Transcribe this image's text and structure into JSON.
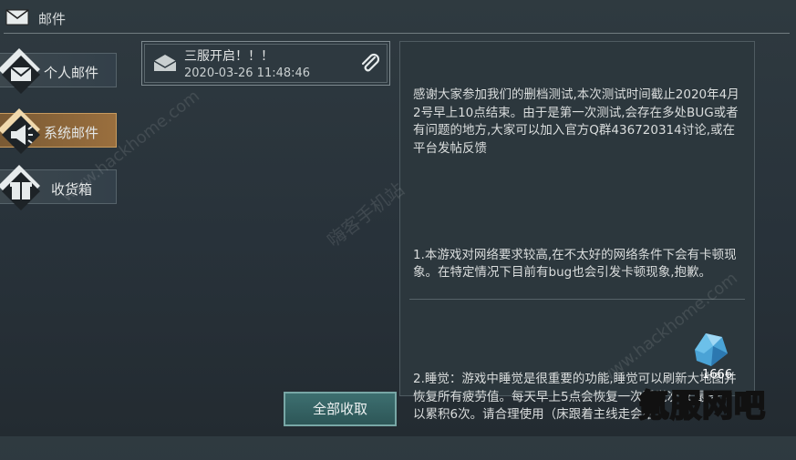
{
  "header": {
    "title": "邮件",
    "icon": "envelope-icon"
  },
  "sidebar": {
    "tabs": [
      {
        "label": "个人邮件",
        "icon": "envelope-icon",
        "active": false
      },
      {
        "label": "系统邮件",
        "icon": "megaphone-icon",
        "active": true
      },
      {
        "label": "收货箱",
        "icon": "box-icon",
        "active": false
      }
    ]
  },
  "mail_list": {
    "items": [
      {
        "subject": "三服开启！！！",
        "time": "2020-03-26 11:48:46",
        "has_attachment": true
      }
    ]
  },
  "mail_content": {
    "paragraphs": [
      "感谢大家参加我们的删档测试,本次测试时间截止2020年4月2号早上10点结束。由于是第一次测试,会存在多处BUG或者有问题的地方,大家可以加入官方Q群436720314讨论,或在平台发帖反馈",
      "1.本游戏对网络要求较高,在不太好的网络条件下会有卡顿现象。在特定情况下目前有bug也会引发卡顿现象,抱歉。",
      "2.睡觉：游戏中睡觉是很重要的功能,睡觉可以刷新大地图并恢复所有疲劳值。每天早上5点会恢复一次睡觉次数,最多可以累积6次。请合理使用（床跟着主线走会给）"
    ],
    "attachment": {
      "icon": "crystal-gem-icon",
      "count": "1666"
    }
  },
  "buttons": {
    "claim_all": "全部收取"
  },
  "watermarks": {
    "site1": "www.hackhome.com",
    "site2": "嗨客手机站",
    "site3": "www.hackhome.com",
    "brand": "氪服网吧"
  },
  "colors": {
    "active_tab": "#9a6f3e",
    "button": "#3d6f70",
    "panel": "#2c373d"
  }
}
